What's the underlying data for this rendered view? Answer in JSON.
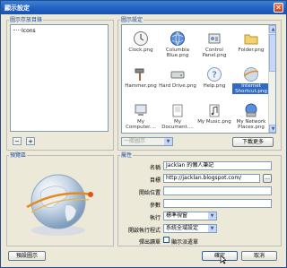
{
  "window": {
    "title": "顯示設定",
    "close_glyph": "✕"
  },
  "left_panel": {
    "label": "圖示存放目錄",
    "tree_items": [
      "Icons"
    ],
    "minus": "−",
    "plus": "+"
  },
  "icon_panel": {
    "label": "圖示設定",
    "icons": [
      {
        "label": "Clock.png",
        "icon": "clock-icon"
      },
      {
        "label": "Columbia Blue.png",
        "icon": "globe-icon"
      },
      {
        "label": "Control Panel.png",
        "icon": "control-panel-icon"
      },
      {
        "label": "Folder.png",
        "icon": "folder-icon"
      },
      {
        "label": "Hammer.png",
        "icon": "hammer-icon"
      },
      {
        "label": "Hard Drive.png",
        "icon": "hard-drive-icon"
      },
      {
        "label": "Help.png",
        "icon": "help-icon"
      },
      {
        "label": "Internet Shortcut.png",
        "icon": "internet-shortcut-icon",
        "selected": true
      },
      {
        "label": "My Computer....",
        "icon": "computer-icon"
      },
      {
        "label": "My Document....",
        "icon": "documents-icon"
      },
      {
        "label": "My Music.png",
        "icon": "music-icon"
      },
      {
        "label": "My Network Places.png",
        "icon": "network-icon"
      }
    ],
    "style_combo": "一般圖示",
    "download_more": "下載更多"
  },
  "preview": {
    "label": "預覽區"
  },
  "properties": {
    "label": "屬性",
    "name_label": "名稱",
    "name_value": "Jacklan 的懶人筆記",
    "target_label": "目標",
    "target_value": "http://jacklan.blogspot.com/",
    "browse": "...",
    "start_pos_label": "開始位置",
    "start_pos_value": "",
    "params_label": "參數",
    "params_value": "",
    "run_label": "執行",
    "run_value": "標準視窗",
    "open_with_label": "開啟執行程式",
    "open_with_value": "系統全域設定",
    "confirm_label": "彈出讀單",
    "confirm_checkbox": "顯示派遣單"
  },
  "footer": {
    "preview_button": "預設圖示",
    "ok_button": "確定",
    "cancel_button": "取消"
  }
}
